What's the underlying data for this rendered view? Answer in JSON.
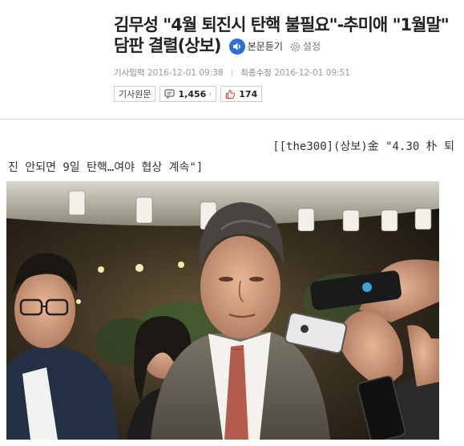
{
  "article": {
    "headline_line1": "김무성 \"4월 퇴진시 탄핵 불필요\"-추미애 \"1월말\"",
    "headline_line2": "담판 결렬(상보)",
    "listen_label": "본문듣기",
    "settings_label": "설정",
    "published_label": "기사입력",
    "published_value": "2016-12-01 09:38",
    "modified_label": "최종수정",
    "modified_value": "2016-12-01 09:51",
    "original_label": "기사원문",
    "comment_count": "1,456",
    "like_count": "174",
    "subhead_line1": "[[the300](상보)金 \"4.30 朴 퇴",
    "subhead_line2": "진 안되면 9일 탄핵…여야 협상 계속\"]"
  },
  "colors": {
    "listen_icon": "#2d6fd6",
    "like_icon": "#e0413b",
    "headline": "#222222"
  }
}
